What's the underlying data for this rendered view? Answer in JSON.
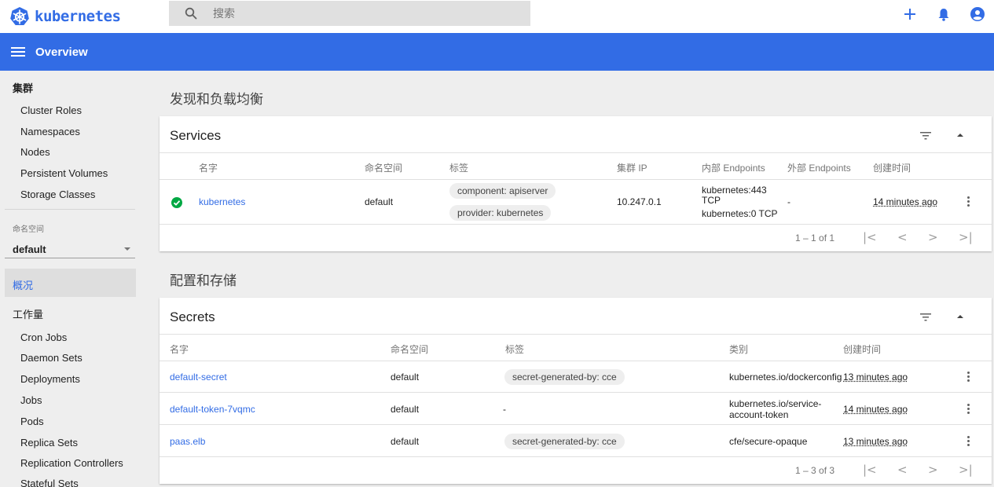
{
  "app": {
    "brand": "kubernetes",
    "search_placeholder": "搜索",
    "page_title": "Overview",
    "brand_color": "#326ce5"
  },
  "top_actions": [
    {
      "icon": "add-icon"
    },
    {
      "icon": "bell-icon"
    },
    {
      "icon": "account-icon"
    }
  ],
  "sidebar": {
    "cluster_header": "集群",
    "cluster_items": [
      "Cluster Roles",
      "Namespaces",
      "Nodes",
      "Persistent Volumes",
      "Storage Classes"
    ],
    "namespace_label": "命名空间",
    "namespace_value": "default",
    "overview_label": "概况",
    "workloads_header": "工作量",
    "workload_items": [
      "Cron Jobs",
      "Daemon Sets",
      "Deployments",
      "Jobs",
      "Pods",
      "Replica Sets",
      "Replication Controllers",
      "Stateful Sets"
    ]
  },
  "sections": {
    "discovery": "发现和负载均衡",
    "config": "配置和存储"
  },
  "services": {
    "title": "Services",
    "columns": [
      "名字",
      "命名空间",
      "标签",
      "集群 IP",
      "内部 Endpoints",
      "外部 Endpoints",
      "创建时间"
    ],
    "rows": [
      {
        "status": "ok",
        "name": "kubernetes",
        "namespace": "default",
        "labels": [
          "component: apiserver",
          "provider: kubernetes"
        ],
        "cluster_ip": "10.247.0.1",
        "internal_endpoints": [
          "kubernetes:443",
          "TCP",
          "kubernetes:0 TCP"
        ],
        "external_endpoints": "-",
        "age": "14 minutes ago"
      }
    ],
    "pagination": "1 – 1 of 1"
  },
  "secrets": {
    "title": "Secrets",
    "columns": [
      "名字",
      "命名空间",
      "标签",
      "类别",
      "创建时间"
    ],
    "rows": [
      {
        "name": "default-secret",
        "namespace": "default",
        "label": "secret-generated-by: cce",
        "type": "kubernetes.io/dockerconfig",
        "type2": "",
        "age": "13 minutes ago"
      },
      {
        "name": "default-token-7vqmc",
        "namespace": "default",
        "label": "-",
        "type": "kubernetes.io/service-",
        "type2": "account-token",
        "age": "14 minutes ago"
      },
      {
        "name": "paas.elb",
        "namespace": "default",
        "label": "secret-generated-by: cce",
        "type": "cfe/secure-opaque",
        "type2": "",
        "age": "13 minutes ago"
      }
    ],
    "pagination": "1 – 3 of 3"
  }
}
